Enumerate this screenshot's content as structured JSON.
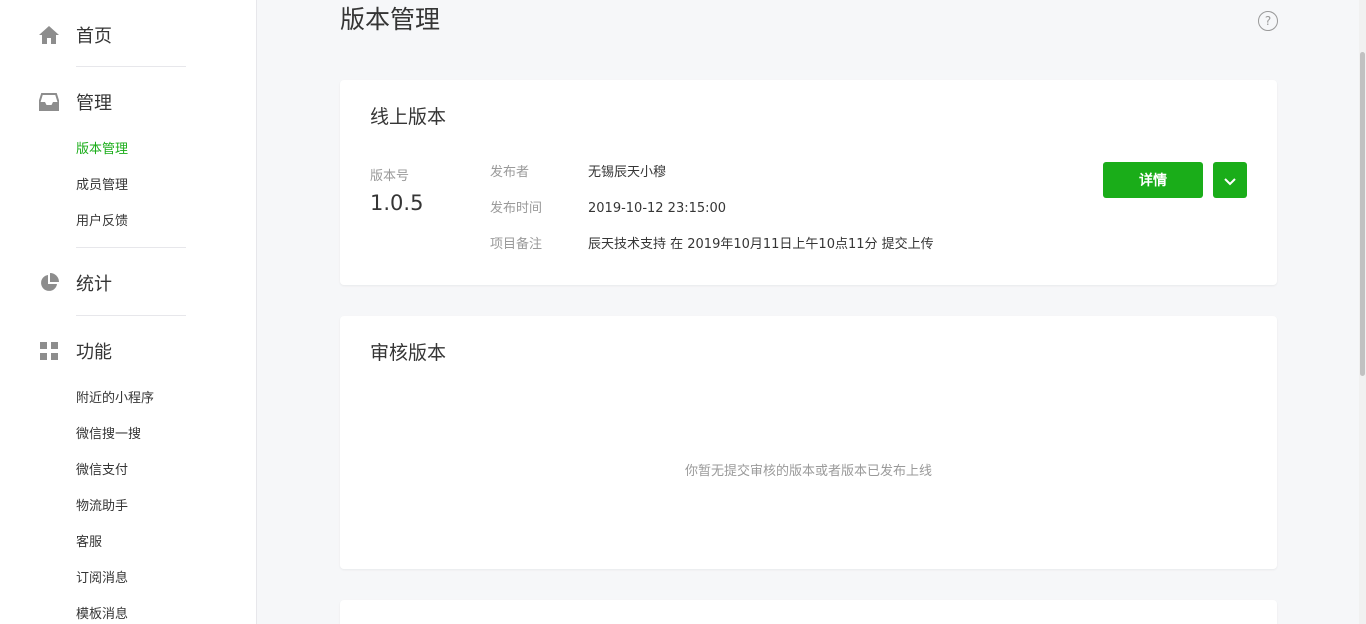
{
  "sidebar": {
    "groups": {
      "home": {
        "label": "首页",
        "icon": "home-icon"
      },
      "manage": {
        "label": "管理",
        "icon": "inbox-icon"
      },
      "stats": {
        "label": "统计",
        "icon": "pie-chart-icon"
      },
      "features": {
        "label": "功能",
        "icon": "grid-icon"
      }
    },
    "manage_items": [
      "版本管理",
      "成员管理",
      "用户反馈"
    ],
    "feature_items": [
      "附近的小程序",
      "微信搜一搜",
      "微信支付",
      "物流助手",
      "客服",
      "订阅消息",
      "模板消息"
    ],
    "active_color": "#1aad19"
  },
  "main": {
    "title": "版本管理",
    "online": {
      "title": "线上版本",
      "version_label": "版本号",
      "version": "1.0.5",
      "publisher_key": "发布者",
      "publisher": "无锡辰天小穆",
      "time_key": "发布时间",
      "time": "2019-10-12 23:15:00",
      "note_key": "项目备注",
      "note": "辰天技术支持 在 2019年10月11日上午10点11分 提交上传",
      "detail_button": "详情"
    },
    "review": {
      "title": "审核版本",
      "empty": "你暂无提交审核的版本或者版本已发布上线"
    }
  },
  "colors": {
    "accent": "#1aad19",
    "text": "#353535",
    "muted": "#9a9a9a"
  }
}
